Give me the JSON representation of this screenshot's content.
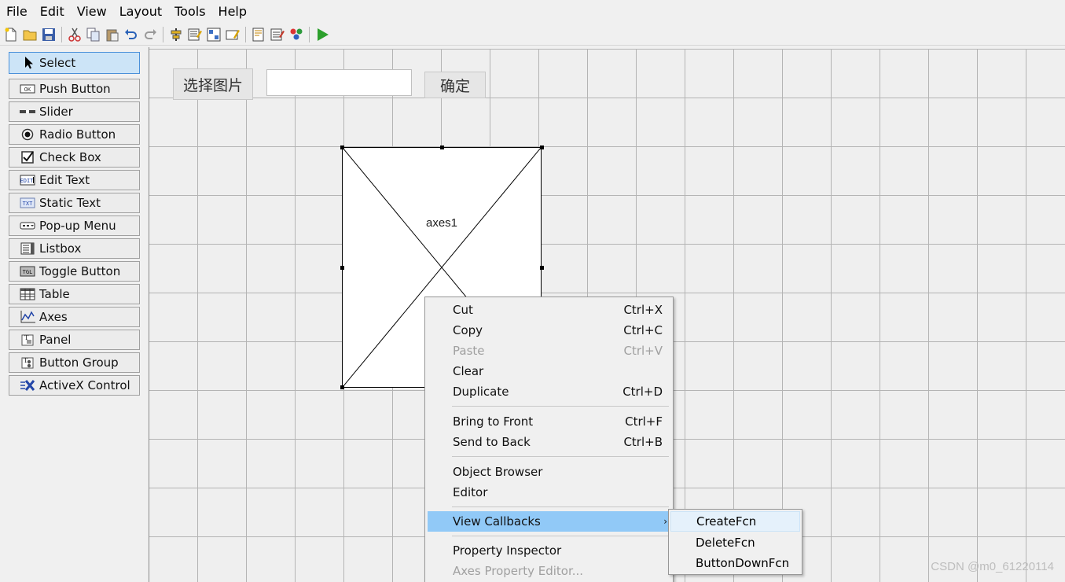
{
  "menubar": [
    "File",
    "Edit",
    "View",
    "Layout",
    "Tools",
    "Help"
  ],
  "toolbar": {
    "icons": [
      "new-file-icon",
      "open-folder-icon",
      "save-icon",
      "cut-icon",
      "copy-icon",
      "paste-icon",
      "undo-icon",
      "redo-icon",
      "align-icon",
      "menu-editor-icon",
      "tab-order-icon",
      "toolbar-editor-icon",
      "editor-icon",
      "property-inspector-icon",
      "object-browser-icon",
      "run-icon"
    ]
  },
  "palette": [
    {
      "label": "Select",
      "icon": "cursor-icon",
      "selected": true
    },
    {
      "label": "Push Button",
      "icon": "push-button-icon"
    },
    {
      "label": "Slider",
      "icon": "slider-icon"
    },
    {
      "label": "Radio Button",
      "icon": "radio-button-icon"
    },
    {
      "label": "Check Box",
      "icon": "check-box-icon"
    },
    {
      "label": "Edit Text",
      "icon": "edit-text-icon"
    },
    {
      "label": "Static Text",
      "icon": "static-text-icon"
    },
    {
      "label": "Pop-up Menu",
      "icon": "popup-menu-icon"
    },
    {
      "label": "Listbox",
      "icon": "listbox-icon"
    },
    {
      "label": "Toggle Button",
      "icon": "toggle-button-icon"
    },
    {
      "label": "Table",
      "icon": "table-icon"
    },
    {
      "label": "Axes",
      "icon": "axes-icon"
    },
    {
      "label": "Panel",
      "icon": "panel-icon"
    },
    {
      "label": "Button Group",
      "icon": "button-group-icon"
    },
    {
      "label": "ActiveX Control",
      "icon": "activex-icon"
    }
  ],
  "canvas": {
    "select_image_button": "选择图片",
    "path_edit_value": "",
    "confirm_button": "确定",
    "axes_label": "axes1"
  },
  "context_menu": {
    "items": [
      {
        "label": "Cut",
        "shortcut": "Ctrl+X"
      },
      {
        "label": "Copy",
        "shortcut": "Ctrl+C"
      },
      {
        "label": "Paste",
        "shortcut": "Ctrl+V",
        "disabled": true
      },
      {
        "label": "Clear",
        "shortcut": ""
      },
      {
        "label": "Duplicate",
        "shortcut": "Ctrl+D"
      },
      {
        "label": "Bring to Front",
        "shortcut": "Ctrl+F"
      },
      {
        "label": "Send to Back",
        "shortcut": "Ctrl+B"
      },
      {
        "label": "Object Browser",
        "shortcut": ""
      },
      {
        "label": "Editor",
        "shortcut": ""
      },
      {
        "label": "View Callbacks",
        "shortcut": "",
        "submenu": true,
        "active": true
      },
      {
        "label": "Property Inspector",
        "shortcut": ""
      },
      {
        "label": "Axes Property Editor...",
        "shortcut": "",
        "disabled": true
      }
    ],
    "submenu": [
      "CreateFcn",
      "DeleteFcn",
      "ButtonDownFcn"
    ]
  },
  "watermark": "CSDN @m0_61220114",
  "colors": {
    "menu_highlight": "#91c9f7",
    "palette_selected": "#cce4f7",
    "run_green": "#2ca02c"
  }
}
